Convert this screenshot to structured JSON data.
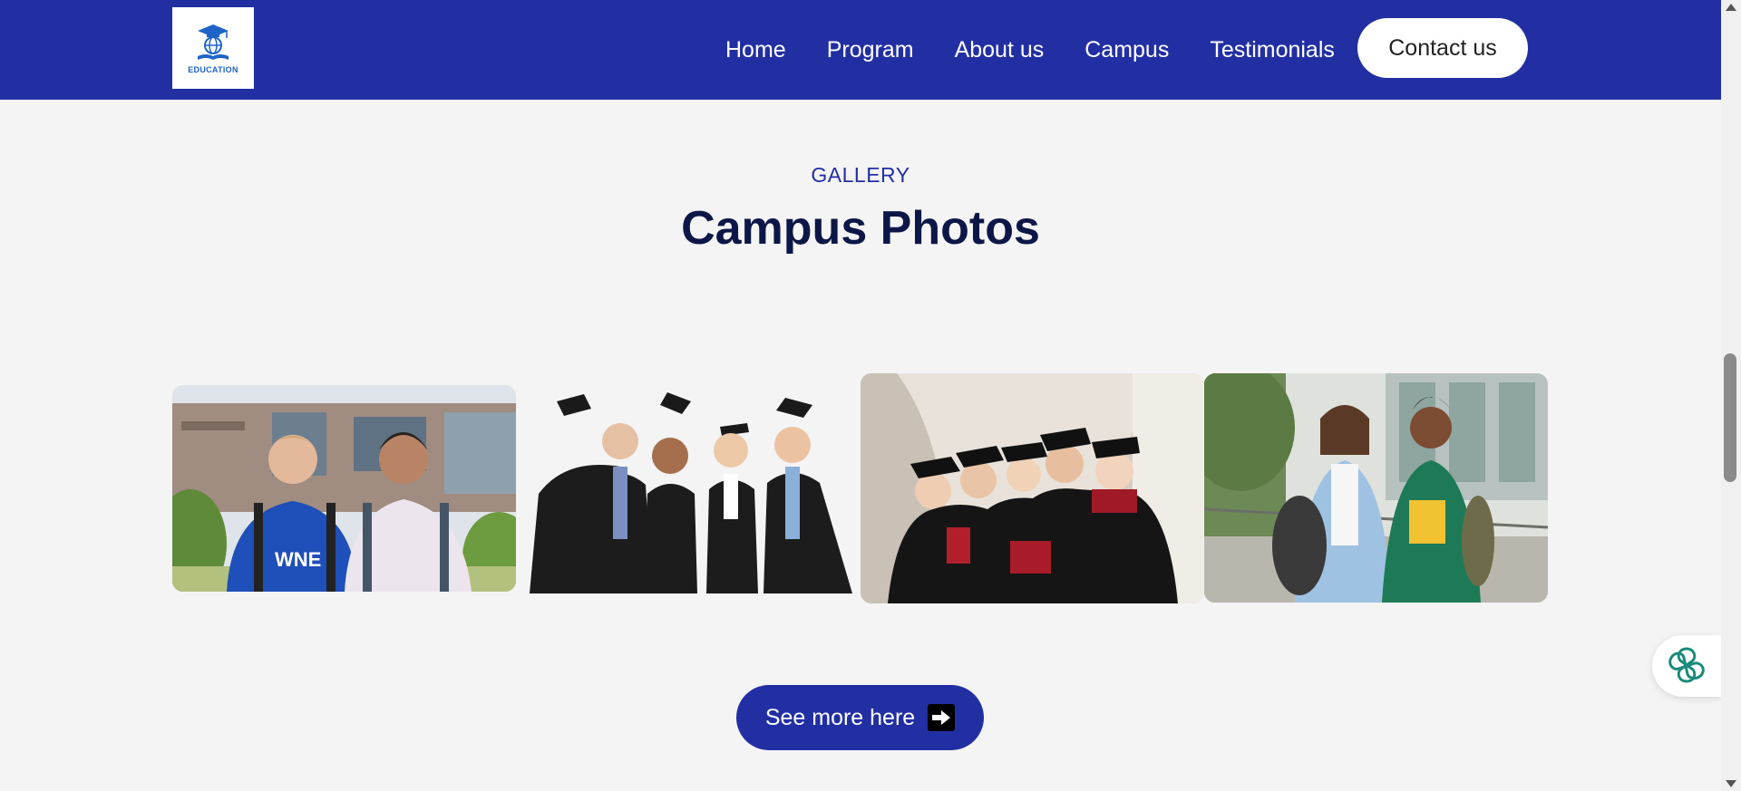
{
  "brand": {
    "logo_text": "EDUCATION",
    "primary_color": "#222fa3",
    "heading_color": "#0d1747"
  },
  "nav": {
    "items": [
      {
        "label": "Home"
      },
      {
        "label": "Program"
      },
      {
        "label": "About us"
      },
      {
        "label": "Campus"
      },
      {
        "label": "Testimonials"
      }
    ],
    "contact_label": "Contact us"
  },
  "gallery": {
    "eyebrow": "GALLERY",
    "title": "Campus Photos",
    "photos": [
      {
        "icon": "two-students-outdoors-photo",
        "shirt_text": "WNE"
      },
      {
        "icon": "graduates-throwing-caps-photo"
      },
      {
        "icon": "graduates-group-hallway-photo"
      },
      {
        "icon": "two-students-walkway-photo"
      }
    ]
  },
  "cta": {
    "label": "See more here",
    "icon": "arrow-right-icon"
  },
  "chat": {
    "icon": "ai-chat-icon"
  }
}
